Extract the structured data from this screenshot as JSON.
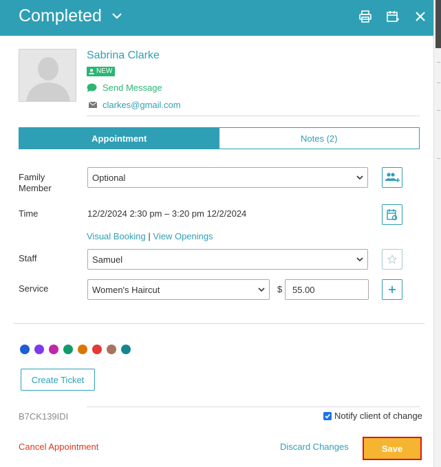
{
  "header": {
    "title": "Completed",
    "status_dropdown_icon": "chevron-down-icon",
    "actions": [
      "print-icon",
      "calendar-add-icon",
      "close-icon"
    ]
  },
  "client": {
    "name": "Sabrina Clarke",
    "badge": "NEW",
    "send_message": "Send Message",
    "email": "clarkes@gmail.com"
  },
  "tabs": [
    {
      "label": "Appointment",
      "active": true
    },
    {
      "label": "Notes (2)",
      "active": false
    }
  ],
  "form": {
    "family_member": {
      "label": "Family Member",
      "value": "Optional"
    },
    "time": {
      "label": "Time",
      "value": "12/2/2024 2:30 pm – 3:20 pm 12/2/2024"
    },
    "links": {
      "visual_booking": "Visual Booking",
      "separator": "|",
      "view_openings": "View Openings"
    },
    "staff": {
      "label": "Staff",
      "value": "Samuel"
    },
    "service": {
      "label": "Service",
      "value": "Women's Haircut",
      "currency": "$",
      "price": "55.00"
    }
  },
  "color_tags": [
    "#1a5fd6",
    "#7c3aed",
    "#c026a8",
    "#119a6a",
    "#d97706",
    "#e53935",
    "#a8745e",
    "#14868f"
  ],
  "footer": {
    "create_ticket": "Create Ticket",
    "ref_code": "B7CK139IDI",
    "notify_label": "Notify client of change",
    "notify_checked": true,
    "cancel": "Cancel Appointment",
    "discard": "Discard Changes",
    "save": "Save"
  },
  "colors": {
    "accent": "#2e9fb5",
    "success": "#2bb673",
    "danger": "#d9381e",
    "save": "#f6b531"
  }
}
